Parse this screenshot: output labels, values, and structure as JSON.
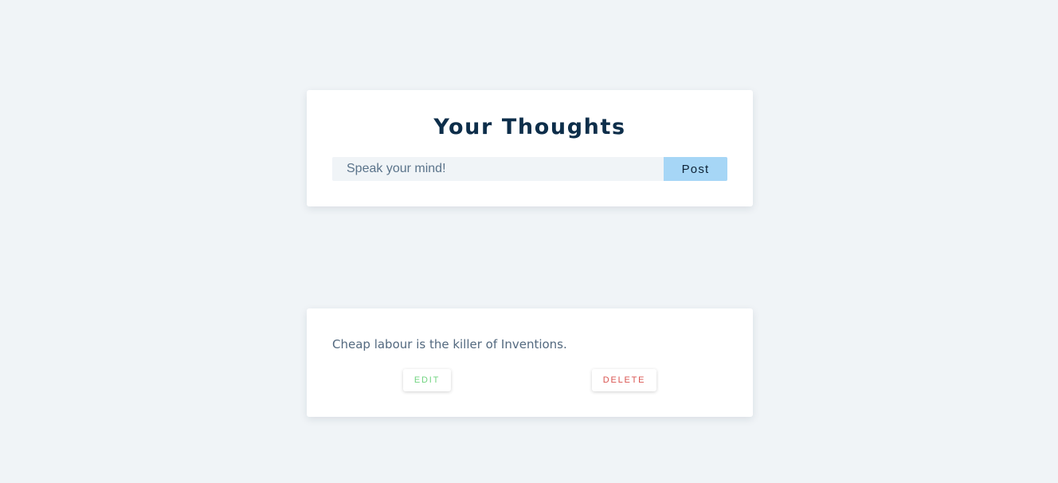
{
  "composer": {
    "title": "Your Thoughts",
    "input_placeholder": "Speak your mind!",
    "input_value": "",
    "post_label": "Post"
  },
  "thoughts": [
    {
      "text": "Cheap labour is the killer of Inventions.",
      "edit_label": "EDIT",
      "delete_label": "DELETE"
    }
  ],
  "colors": {
    "background": "#f0f4f7",
    "card": "#ffffff",
    "title": "#0d2e4a",
    "post_button": "#a6d6f6",
    "edit": "#6fd37f",
    "delete": "#d9534f"
  }
}
